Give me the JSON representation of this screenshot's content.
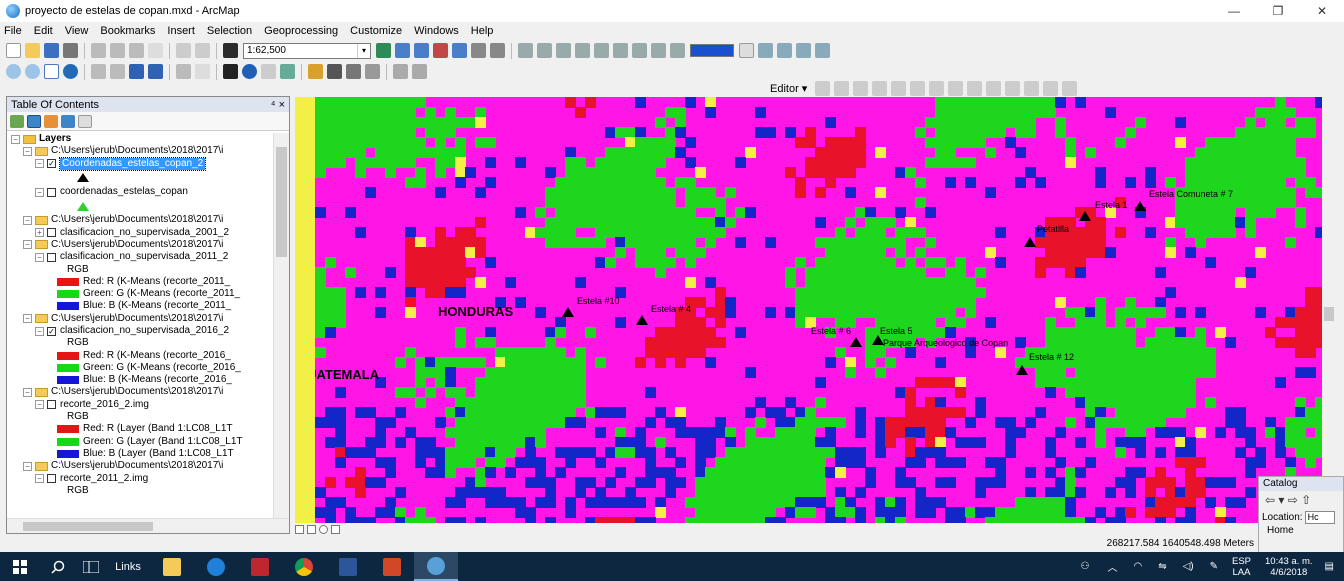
{
  "window": {
    "title": "proyecto de estelas de copan.mxd - ArcMap",
    "minimize": "—",
    "maximize": "❐",
    "close": "✕"
  },
  "menu": [
    "File",
    "Edit",
    "View",
    "Bookmarks",
    "Insert",
    "Selection",
    "Geoprocessing",
    "Customize",
    "Windows",
    "Help"
  ],
  "toolbar": {
    "scale": "1:62,500",
    "editor_label": "Editor ▾"
  },
  "toc": {
    "title": "Table Of Contents",
    "pin": "⁴ ×",
    "rows": [
      {
        "type": "group",
        "text": "Layers",
        "exp": "⊟",
        "bold": true
      },
      {
        "type": "folder",
        "text": "C:\\Users\\jerub\\Documents\\2018\\2017\\i",
        "exp": "⊟"
      },
      {
        "type": "layer",
        "text": "Coordenadas_estelas_copan_2",
        "checked": "✓",
        "selected": true,
        "exp": "⊟"
      },
      {
        "type": "sym",
        "sym": "black-triangle"
      },
      {
        "type": "layer",
        "text": "coordenadas_estelas_copan",
        "checked": "",
        "exp": "⊟"
      },
      {
        "type": "sym",
        "sym": "green-triangle"
      },
      {
        "type": "folder",
        "text": "C:\\Users\\jerub\\Documents\\2018\\2017\\i",
        "exp": "⊟"
      },
      {
        "type": "layer",
        "text": "clasificacion_no_supervisada_2001_2",
        "checked": "",
        "exp": "⊞"
      },
      {
        "type": "folder",
        "text": "C:\\Users\\jerub\\Documents\\2018\\2017\\i",
        "exp": "⊟"
      },
      {
        "type": "layer",
        "text": "clasificacion_no_supervisada_2011_2",
        "checked": "",
        "exp": "⊟"
      },
      {
        "type": "rgb",
        "text": "RGB"
      },
      {
        "type": "band",
        "text": "Red:   R (K-Means (recorte_2011_",
        "color": "#e51616"
      },
      {
        "type": "band",
        "text": "Green: G (K-Means (recorte_2011_",
        "color": "#16d916"
      },
      {
        "type": "band",
        "text": "Blue:   B (K-Means (recorte_2011_",
        "color": "#1616d9"
      },
      {
        "type": "folder",
        "text": "C:\\Users\\jerub\\Documents\\2018\\2017\\i",
        "exp": "⊟"
      },
      {
        "type": "layer",
        "text": "clasificacion_no_supervisada_2016_2",
        "checked": "✓",
        "exp": "⊟"
      },
      {
        "type": "rgb",
        "text": "RGB"
      },
      {
        "type": "band",
        "text": "Red:   R (K-Means (recorte_2016_",
        "color": "#e51616"
      },
      {
        "type": "band",
        "text": "Green: G (K-Means (recorte_2016_",
        "color": "#16d916"
      },
      {
        "type": "band",
        "text": "Blue:   B (K-Means (recorte_2016_",
        "color": "#1616d9"
      },
      {
        "type": "folder",
        "text": "C:\\Users\\jerub\\Documents\\2018\\2017\\i",
        "exp": "⊟"
      },
      {
        "type": "layer",
        "text": "recorte_2016_2.img",
        "checked": "",
        "exp": "⊟"
      },
      {
        "type": "rgb",
        "text": "RGB"
      },
      {
        "type": "band",
        "text": "Red:   R (Layer (Band 1:LC08_L1T",
        "color": "#e51616"
      },
      {
        "type": "band",
        "text": "Green: G (Layer (Band 1:LC08_L1T",
        "color": "#16d916"
      },
      {
        "type": "band",
        "text": "Blue:   B (Layer (Band 1:LC08_L1T",
        "color": "#1616d9"
      },
      {
        "type": "folder",
        "text": "C:\\Users\\jerub\\Documents\\2018\\2017\\i",
        "exp": "⊟"
      },
      {
        "type": "layer",
        "text": "recorte_2011_2.img",
        "checked": "",
        "exp": "⊟"
      },
      {
        "type": "rgb",
        "text": "RGB"
      }
    ]
  },
  "map": {
    "labels": {
      "honduras": "HONDURAS",
      "guatemala": "GUATEMALA",
      "estela10": "Estela #10",
      "estela4": "Estela # 4",
      "estela6": "Estela # 6",
      "estela5": "Estela 5",
      "parque": "Parque Arqueologico de Copan",
      "estela12": "Estela # 12",
      "petatilla": "Petatilla",
      "estela1": "Estela 1",
      "estela7": "Estela Comuneta # 7"
    }
  },
  "status": {
    "coords": "268217.584  1640548.498 Meters"
  },
  "catalog": {
    "title": "Catalog",
    "nav": "⇦ ▾ ⇨ ⇧",
    "location_label": "Location:",
    "location_value": "Hc",
    "home": "Home"
  },
  "taskbar": {
    "links": "Links",
    "lang_top": "ESP",
    "lang_bottom": "LAA",
    "time": "10:43 a. m.",
    "date": "4/6/2018"
  },
  "colors": {
    "magenta": "#ff16e6",
    "green": "#1fd61f",
    "red": "#e8132a",
    "blue": "#1426c8",
    "yellow": "#f2ef47",
    "taskbar": "#0e2740"
  }
}
